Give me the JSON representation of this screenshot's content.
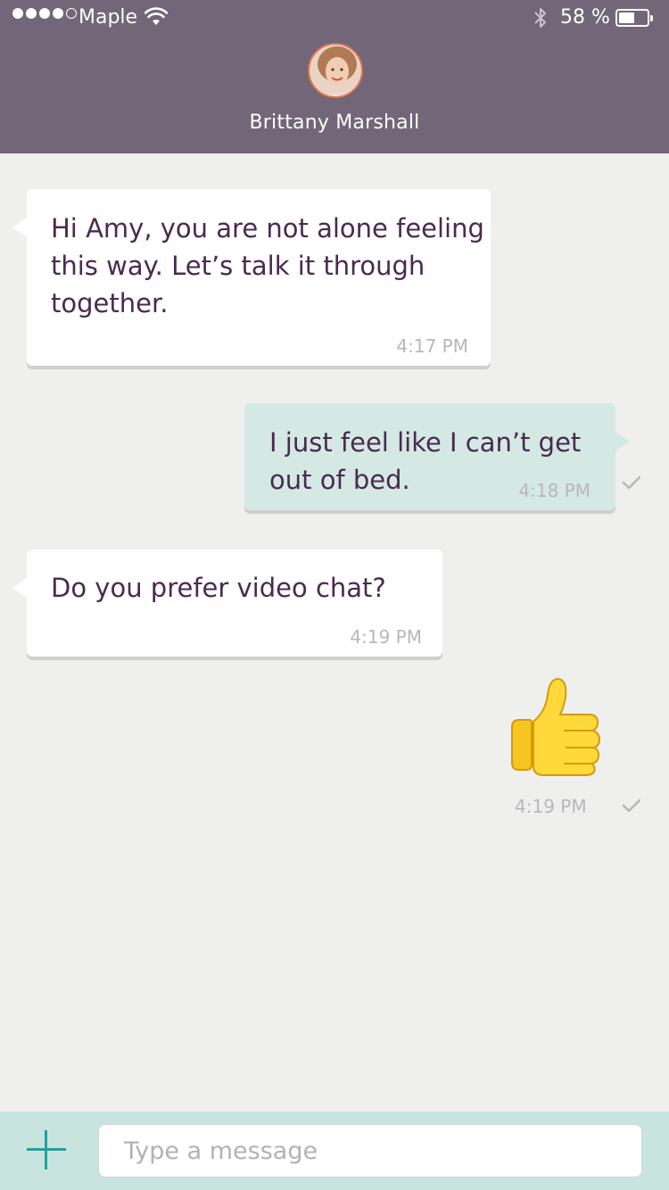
{
  "status_bar": {
    "carrier": "Maple",
    "battery_percent": "58 %",
    "battery_level": 0.58,
    "signal_bars": 4,
    "signal_total": 5,
    "icons": [
      "signal-dots-icon",
      "wifi-icon",
      "bluetooth-icon",
      "battery-icon"
    ]
  },
  "header": {
    "contact_name": "Brittany Marshall",
    "avatar": "contact-avatar",
    "color": "#736679"
  },
  "messages": [
    {
      "direction": "incoming",
      "text_lines": [
        "Hi Amy, you are not alone feeling",
        "this way. Let’s talk it through",
        "together."
      ],
      "time": "4:17 PM"
    },
    {
      "direction": "outgoing",
      "text_lines": [
        "I just feel like I can’t get",
        "out of bed."
      ],
      "time": "4:18 PM",
      "status_icon": "checkmark-icon"
    },
    {
      "direction": "incoming",
      "text_lines": [
        "Do you prefer video chat?"
      ],
      "time": "4:19 PM"
    },
    {
      "direction": "outgoing",
      "emoji": "thumbs-up-icon",
      "time": "4:19 PM",
      "status_icon": "checkmark-icon"
    }
  ],
  "composer": {
    "placeholder": "Type a message",
    "add_icon": "plus-icon",
    "accent": "#2a9d99"
  },
  "colors": {
    "incoming_bubble": "#ffffff",
    "outgoing_bubble": "#d4e9e4",
    "text": "#4a2a4f",
    "background": "#efefed"
  }
}
